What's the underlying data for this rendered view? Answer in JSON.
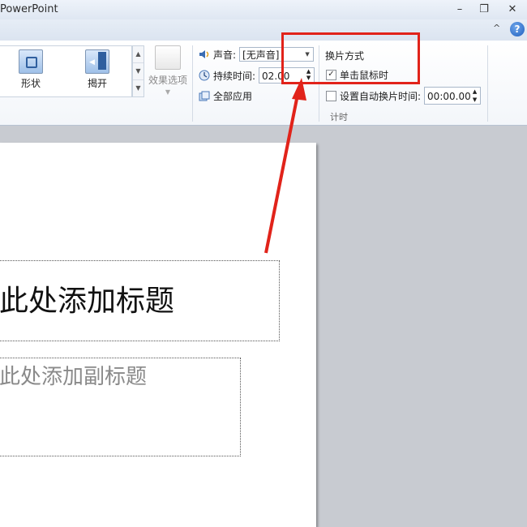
{
  "window": {
    "title": "PowerPoint",
    "minimize": "–",
    "restore": "❐",
    "close": "✕"
  },
  "ribbon": {
    "collapse": "^",
    "help": "?",
    "transitions": [
      {
        "label": "形状",
        "icon": "shape-transition-icon"
      },
      {
        "label": "揭开",
        "icon": "uncover-transition-icon"
      }
    ],
    "effect_options_label": "效果选项",
    "sound_label": "声音:",
    "sound_value": "[无声音]",
    "duration_label": "持续时间:",
    "duration_value": "02.00",
    "apply_all_label": "全部应用",
    "advance_slide_title": "换片方式",
    "on_mouse_click_label": "单击鼠标时",
    "on_mouse_click_checked": true,
    "auto_advance_label": "设置自动换片时间:",
    "auto_advance_checked": false,
    "auto_advance_value": "00:00.00",
    "timing_group_label": "计时"
  },
  "slide": {
    "title_placeholder": "此处添加标题",
    "subtitle_placeholder": "击此处添加副标题"
  },
  "annotation_color": "#e1231a"
}
